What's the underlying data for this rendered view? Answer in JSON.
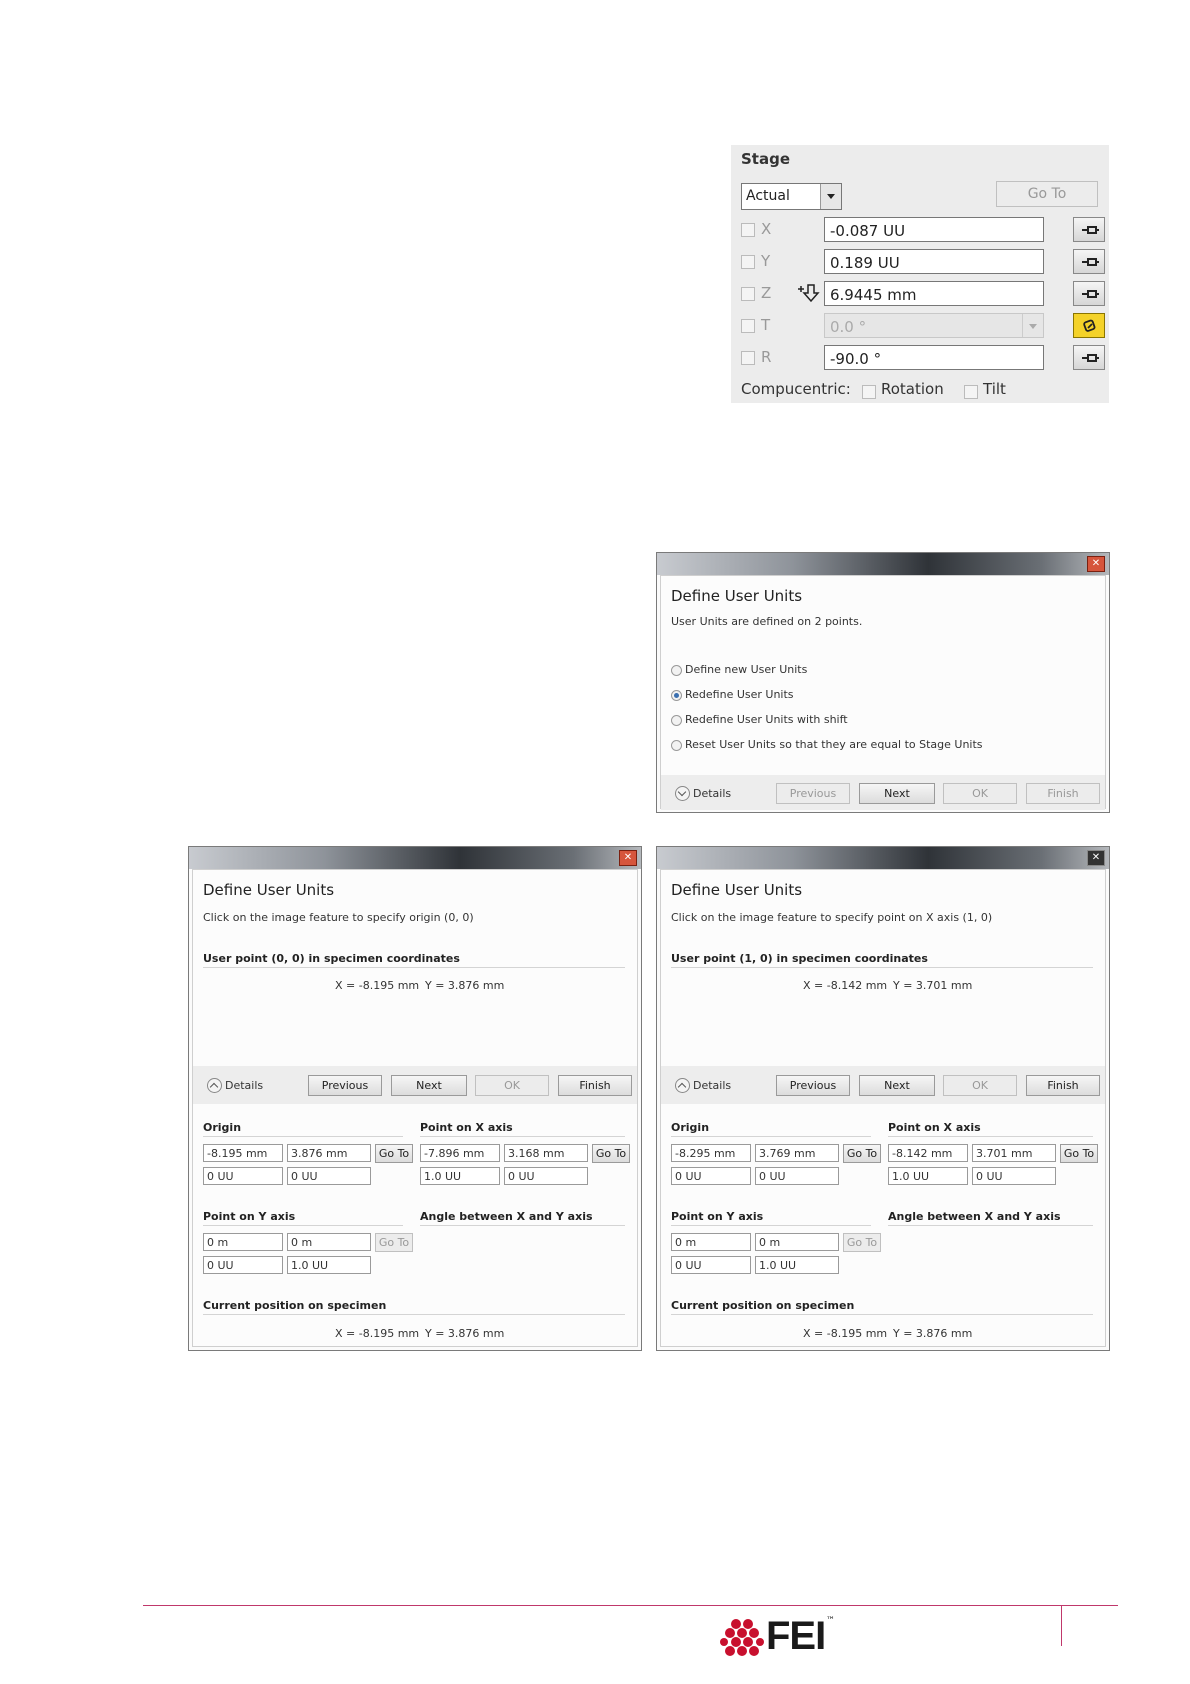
{
  "stage": {
    "title": "Stage",
    "mode": "Actual",
    "goto": "Go To",
    "axes": [
      {
        "label": "X",
        "value": "-0.087 UU"
      },
      {
        "label": "Y",
        "value": "0.189 UU"
      },
      {
        "label": "Z",
        "value": "6.9445 mm"
      },
      {
        "label": "T",
        "value": "0.0 °"
      },
      {
        "label": "R",
        "value": "-90.0 °"
      }
    ],
    "compucentric": "Compucentric:",
    "rotation": "Rotation",
    "tilt": "Tilt"
  },
  "dialog1": {
    "title": "Define User Units",
    "subtitle": "User Units are defined on 2 points.",
    "options": [
      "Define new User Units",
      "Redefine User Units",
      "Redefine User Units with shift",
      "Reset User Units so that they are equal to Stage Units"
    ],
    "selected_index": 1,
    "details": "Details",
    "buttons": {
      "previous": "Previous",
      "next": "Next",
      "ok": "OK",
      "finish": "Finish"
    }
  },
  "dialog2": {
    "title": "Define User Units",
    "instruction": "Click on the image feature to specify origin (0, 0)",
    "section": "User point (0, 0) in specimen coordinates",
    "coords": {
      "x": "X = -8.195 mm",
      "y": "Y = 3.876 mm"
    },
    "details": "Details",
    "buttons": {
      "previous": "Previous",
      "next": "Next",
      "ok": "OK",
      "finish": "Finish"
    },
    "origin": {
      "label": "Origin",
      "row1": [
        "-8.195 mm",
        "3.876 mm"
      ],
      "row2": [
        "0 UU",
        "0 UU"
      ],
      "goto": "Go To"
    },
    "point_x": {
      "label": "Point on X axis",
      "row1": [
        "-7.896 mm",
        "3.168 mm"
      ],
      "row2": [
        "1.0 UU",
        "0 UU"
      ],
      "goto": "Go To"
    },
    "point_y": {
      "label": "Point on Y axis",
      "row1": [
        "0 m",
        "0 m"
      ],
      "row2": [
        "0 UU",
        "1.0 UU"
      ],
      "goto": "Go To"
    },
    "angle": {
      "label": "Angle between X and Y axis"
    },
    "current": {
      "label": "Current position on specimen",
      "x": "X = -8.195 mm",
      "y": "Y = 3.876 mm"
    }
  },
  "dialog3": {
    "title": "Define User Units",
    "instruction": "Click on the image feature to specify point on X axis (1, 0)",
    "section": "User point (1, 0) in specimen coordinates",
    "coords": {
      "x": "X = -8.142 mm",
      "y": "Y = 3.701 mm"
    },
    "details": "Details",
    "buttons": {
      "previous": "Previous",
      "next": "Next",
      "ok": "OK",
      "finish": "Finish"
    },
    "origin": {
      "label": "Origin",
      "row1": [
        "-8.295 mm",
        "3.769 mm"
      ],
      "row2": [
        "0 UU",
        "0 UU"
      ],
      "goto": "Go To"
    },
    "point_x": {
      "label": "Point on X axis",
      "row1": [
        "-8.142 mm",
        "3.701 mm"
      ],
      "row2": [
        "1.0 UU",
        "0 UU"
      ],
      "goto": "Go To"
    },
    "point_y": {
      "label": "Point on Y axis",
      "row1": [
        "0 m",
        "0 m"
      ],
      "row2": [
        "0 UU",
        "1.0 UU"
      ],
      "goto": "Go To"
    },
    "angle": {
      "label": "Angle between X and Y axis"
    },
    "current": {
      "label": "Current position on specimen",
      "x": "X = -8.195 mm",
      "y": "Y = 3.876 mm"
    }
  },
  "footer": {
    "logo_text": "FEI",
    "logo_mark": "™",
    "accent": "#c0386b",
    "logo_color": "#c8102e"
  }
}
